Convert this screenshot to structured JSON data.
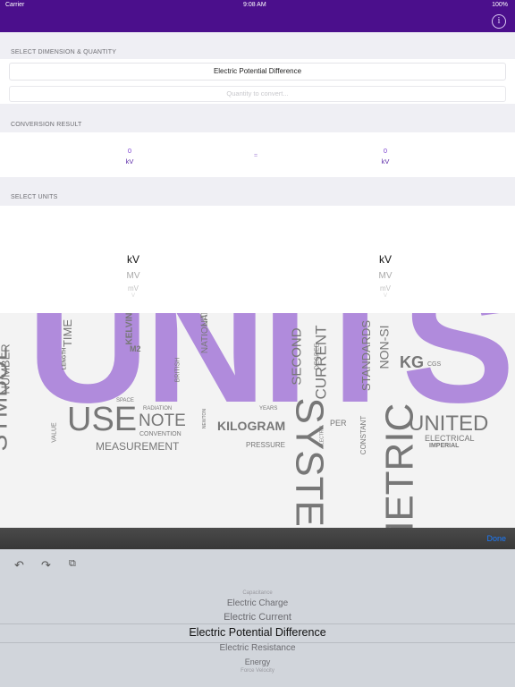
{
  "status": {
    "carrier": "Carrier",
    "time": "9:08 AM",
    "battery": "100%"
  },
  "nav": {
    "info_icon": "info-icon",
    "info_glyph": "i"
  },
  "sections": {
    "dimension_header": "SELECT DIMENSION & QUANTITY",
    "result_header": "CONVERSION RESULT",
    "units_header": "SELECT UNITS"
  },
  "dimension_field": {
    "value": "Electric Potential Difference"
  },
  "amount_field": {
    "placeholder": "Quantity to convert..."
  },
  "result": {
    "from_value": "0",
    "from_unit": "kV",
    "equals": "=",
    "to_value": "0",
    "to_unit": "kV"
  },
  "unit_pickers": {
    "from": {
      "selected": "kV",
      "options": [
        "MV",
        "mV",
        "V"
      ]
    },
    "to": {
      "selected": "kV",
      "options": [
        "MV",
        "mV",
        "V"
      ]
    }
  },
  "word_cloud": {
    "accent_color": "#a57ad8",
    "words": [
      "UNITS",
      "SYMBOL",
      "NUMBER",
      "TIME",
      "KELVIN",
      "M2",
      "LENGTH",
      "USE",
      "NOTE",
      "SPACE",
      "NATIONAL",
      "LITRE",
      "SECOND",
      "CURRENT",
      "DEGREE",
      "STANDARDS",
      "NON-SI",
      "KG",
      "CGS",
      "BRITISH",
      "KILOGRAM",
      "PER",
      "UNITED",
      "ELECTRICAL",
      "IMPERIAL",
      "VALUE",
      "MEASUREMENT",
      "CONVENTION",
      "RADIATION",
      "NEWTON",
      "PRESSURE",
      "SYSTEM",
      "METRIC",
      "CONSTANT",
      "ELECTRIC",
      "YEARS"
    ]
  },
  "toolbar": {
    "done_label": "Done"
  },
  "keyboard_bar": {
    "undo_icon": "undo-icon",
    "redo_icon": "redo-icon",
    "paste_icon": "paste-icon"
  },
  "quantity_picker": {
    "options": [
      "Capacitance",
      "Electric Charge",
      "Electric Current",
      "Electric Potential Difference",
      "Electric Resistance",
      "Energy",
      "Force Velocity"
    ],
    "selected": "Electric Potential Difference"
  }
}
